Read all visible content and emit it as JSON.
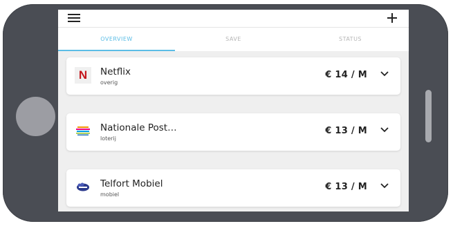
{
  "header": {
    "menu_icon": "hamburger-icon",
    "add_icon": "plus-icon"
  },
  "tabs": [
    {
      "label": "OVERVIEW",
      "active": true
    },
    {
      "label": "SAVE",
      "active": false
    },
    {
      "label": "STATUS",
      "active": false
    }
  ],
  "subscriptions": [
    {
      "name": "Netflix",
      "category": "overig",
      "price": "€ 14 / M",
      "logo_letter": "N",
      "logo_icon": "netflix-logo"
    },
    {
      "name": "Nationale Post…",
      "category": "loterij",
      "price": "€ 13 / M",
      "logo_icon": "nationale-postcode-loterij-logo"
    },
    {
      "name": "Telfort Mobiel",
      "category": "mobiel",
      "price": "€ 13 / M",
      "logo_icon": "telfort-logo"
    }
  ],
  "colors": {
    "accent": "#5bbde6",
    "phone_frame": "#4a4d54",
    "netflix_red": "#c4161c"
  }
}
